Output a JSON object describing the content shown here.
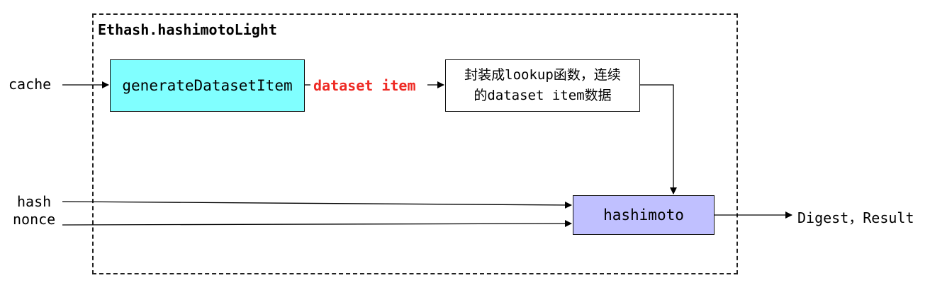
{
  "diagram": {
    "frame_title": "Ethash.hashimotoLight",
    "inputs": {
      "cache": "cache",
      "hash": "hash",
      "nonce": "nonce"
    },
    "nodes": {
      "generate": "generateDatasetItem",
      "lookup_line1": "封装成lookup函数，连续",
      "lookup_line2": "的dataset item数据",
      "hashimoto": "hashimoto"
    },
    "edge_label": "dataset item",
    "output": "Digest，Result",
    "colors": {
      "generate_fill": "#80ffff",
      "hashimoto_fill": "#c0c0ff",
      "edge_label": "#ee2a24"
    }
  }
}
